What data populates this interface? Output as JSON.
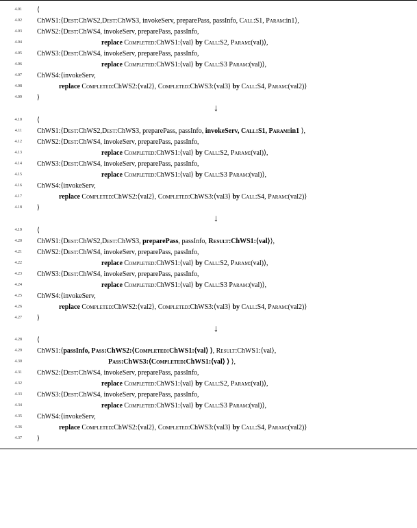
{
  "lines": [
    {
      "ln": "4.01",
      "cls": "indent1",
      "html": "⟨"
    },
    {
      "ln": "4.02",
      "cls": "indent1",
      "html": "ChWS1:⟨<span class='sc'>Dest</span>:ChWS2,<span class='sc'>Dest</span>:ChWS3, invokeServ, preparePass, passInfo, <span class='sc'>Call</span>:S1, <span class='sc'>Param</span>:in1⟩,"
    },
    {
      "ln": "4.03",
      "cls": "indent1",
      "html": "ChWS2:⟨<span class='sc'>Dest</span>:ChWS4, invokeServ, preparePass, passInfo,"
    },
    {
      "ln": "4.04",
      "cls": "indent2",
      "html": "<b>replace</b> <span class='sc'>Completed</span>:ChWS1:⟨val⟩ <b>by</b> <span class='sc'>Call</span>:S2, <span class='sc'>Param</span>:(val)⟩,"
    },
    {
      "ln": "4.05",
      "cls": "indent1",
      "html": "ChWS3:⟨<span class='sc'>Dest</span>:ChWS4, invokeServ, preparePass, passInfo,"
    },
    {
      "ln": "4.06",
      "cls": "indent2",
      "html": "<b>replace</b> <span class='sc'>Completed</span>:ChWS1:⟨val⟩ <b>by</b> <span class='sc'>Call</span>:S3 <span class='sc'>Param</span>:(val)⟩,"
    },
    {
      "ln": "4.07",
      "cls": "indent1",
      "html": "ChWS4:⟨invokeServ,"
    },
    {
      "ln": "4.08",
      "cls": "indent3",
      "html": "<b>replace</b> <span class='sc'>Completed</span>:ChWS2:⟨val2⟩, <span class='sc'>Completed</span>:ChWS3:⟨val3⟩ <b>by</b> <span class='sc'>Call</span>:S4, <span class='sc'>Param</span>:(val2)⟩"
    },
    {
      "ln": "4.09",
      "cls": "indent1",
      "html": "⟩"
    },
    {
      "ln": "",
      "cls": "arrow",
      "html": "↓"
    },
    {
      "ln": "4.10",
      "cls": "indent1",
      "html": "⟨"
    },
    {
      "ln": "4.11",
      "cls": "indent1",
      "html": "ChWS1:⟨<span class='sc'>Dest</span>:ChWS2,<span class='sc'>Dest</span>:ChWS3, preparePass, passInfo, <b>invokeServ, <span class='sc'>Call</span>:S1, <span class='sc'>Param</span>:in1</b> ⟩,"
    },
    {
      "ln": "4.12",
      "cls": "indent1",
      "html": "ChWS2:⟨<span class='sc'>Dest</span>:ChWS4, invokeServ, preparePass, passInfo,"
    },
    {
      "ln": "4.13",
      "cls": "indent2",
      "html": "<b>replace</b> <span class='sc'>Completed</span>:ChWS1:⟨val⟩ <b>by</b> <span class='sc'>Call</span>:S2, <span class='sc'>Param</span>:(val)⟩,"
    },
    {
      "ln": "4.14",
      "cls": "indent1",
      "html": "ChWS3:⟨<span class='sc'>Dest</span>:ChWS4, invokeServ, preparePass, passInfo,"
    },
    {
      "ln": "4.15",
      "cls": "indent2",
      "html": "<b>replace</b> <span class='sc'>Completed</span>:ChWS1:⟨val⟩ <b>by</b> <span class='sc'>Call</span>:S3 <span class='sc'>Param</span>:(val)⟩,"
    },
    {
      "ln": "4.16",
      "cls": "indent1",
      "html": "ChWS4:⟨invokeServ,"
    },
    {
      "ln": "4.17",
      "cls": "indent3",
      "html": "<b>replace</b> <span class='sc'>Completed</span>:ChWS2:⟨val2⟩, <span class='sc'>Completed</span>:ChWS3:⟨val3⟩ <b>by</b> <span class='sc'>Call</span>:S4, <span class='sc'>Param</span>:(val2)⟩"
    },
    {
      "ln": "4.18",
      "cls": "indent1",
      "html": "⟩"
    },
    {
      "ln": "",
      "cls": "arrow",
      "html": "↓"
    },
    {
      "ln": "4.19",
      "cls": "indent1",
      "html": "⟨"
    },
    {
      "ln": "4.20",
      "cls": "indent1",
      "html": "ChWS1:⟨<span class='sc'>Dest</span>:ChWS2,<span class='sc'>Dest</span>:ChWS3, <b>preparePass</b>, passInfo, <b><span class='sc'>Result</span>:ChWS1:⟨val⟩</b>⟩,"
    },
    {
      "ln": "4.21",
      "cls": "indent1",
      "html": "ChWS2:⟨<span class='sc'>Dest</span>:ChWS4, invokeServ, preparePass, passInfo,"
    },
    {
      "ln": "4.22",
      "cls": "indent2",
      "html": "<b>replace</b> <span class='sc'>Completed</span>:ChWS1:⟨val⟩ <b>by</b> <span class='sc'>Call</span>:S2, <span class='sc'>Param</span>:(val)⟩,"
    },
    {
      "ln": "4.23",
      "cls": "indent1",
      "html": "ChWS3:⟨<span class='sc'>Dest</span>:ChWS4, invokeServ, preparePass, passInfo,"
    },
    {
      "ln": "4.24",
      "cls": "indent2",
      "html": "<b>replace</b> <span class='sc'>Completed</span>:ChWS1:⟨val⟩ <b>by</b> <span class='sc'>Call</span>:S3 <span class='sc'>Param</span>:(val)⟩,"
    },
    {
      "ln": "4.25",
      "cls": "indent1",
      "html": "ChWS4:⟨invokeServ,"
    },
    {
      "ln": "4.26",
      "cls": "indent3",
      "html": "<b>replace</b> <span class='sc'>Completed</span>:ChWS2:⟨val2⟩, <span class='sc'>Completed</span>:ChWS3:⟨val3⟩ <b>by</b> <span class='sc'>Call</span>:S4, <span class='sc'>Param</span>:(val2)⟩"
    },
    {
      "ln": "4.27",
      "cls": "indent1",
      "html": "⟩"
    },
    {
      "ln": "",
      "cls": "arrow",
      "html": "↓"
    },
    {
      "ln": "4.28",
      "cls": "indent1",
      "html": "⟨"
    },
    {
      "ln": "4.29",
      "cls": "indent1",
      "html": "ChWS1:⟨<b>passInfo, <span class='sc'>Pass</span>:ChWS2:⟨<span class='sc'>Completed</span>:ChWS1:⟨val⟩ ⟩</b>, <span class='sc'>Result</span>:ChWS1:⟨val⟩,"
    },
    {
      "ln": "4.30",
      "cls": "indent4",
      "html": "<b><span class='sc'>Pass</span>:ChWS3:⟨<span class='sc'>Completed</span>:ChWS1:⟨val⟩ ⟩</b> ⟩,"
    },
    {
      "ln": "4.31",
      "cls": "indent1",
      "html": "ChWS2:⟨<span class='sc'>Dest</span>:ChWS4, invokeServ, preparePass, passInfo,"
    },
    {
      "ln": "4.32",
      "cls": "indent2",
      "html": "<b>replace</b> <span class='sc'>Completed</span>:ChWS1:⟨val⟩ <b>by</b> <span class='sc'>Call</span>:S2, <span class='sc'>Param</span>:(val)⟩,"
    },
    {
      "ln": "4.33",
      "cls": "indent1",
      "html": "ChWS3:⟨<span class='sc'>Dest</span>:ChWS4, invokeServ, preparePass, passInfo,"
    },
    {
      "ln": "4.34",
      "cls": "indent2",
      "html": "<b>replace</b> <span class='sc'>Completed</span>:ChWS1:⟨val⟩ <b>by</b> <span class='sc'>Call</span>:S3 <span class='sc'>Param</span>:(val)⟩,"
    },
    {
      "ln": "4.35",
      "cls": "indent1",
      "html": "ChWS4:⟨invokeServ,"
    },
    {
      "ln": "4.36",
      "cls": "indent3",
      "html": "<b>replace</b> <span class='sc'>Completed</span>:ChWS2:⟨val2⟩, <span class='sc'>Completed</span>:ChWS3:⟨val3⟩ <b>by</b> <span class='sc'>Call</span>:S4, <span class='sc'>Param</span>:(val2)⟩"
    },
    {
      "ln": "4.37",
      "cls": "indent1",
      "html": "⟩"
    }
  ]
}
